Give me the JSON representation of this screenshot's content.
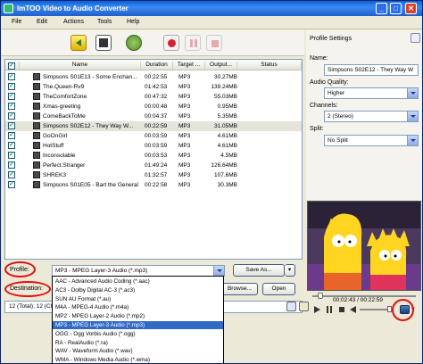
{
  "window": {
    "title": "ImTOO Video to Audio Converter",
    "buttons": [
      "_",
      "□",
      "✕"
    ]
  },
  "menu": [
    "File",
    "Edit",
    "Actions",
    "Tools",
    "Help"
  ],
  "list": {
    "columns": [
      "Name",
      "Duration",
      "Target ...",
      "Output...",
      "Status"
    ],
    "rows": [
      {
        "name": "Simpsons S01E13 - Some Enchan...",
        "duration": "00:22:55",
        "target": "MP3",
        "output": "30.27MB"
      },
      {
        "name": "The.Queen-Rv9",
        "duration": "01:42:53",
        "target": "MP3",
        "output": "139.24MB"
      },
      {
        "name": "TheComfortZone",
        "duration": "00:47:32",
        "target": "MP3",
        "output": "55.03MB"
      },
      {
        "name": "Xmas-greeting",
        "duration": "00:00:48",
        "target": "MP3",
        "output": "0.95MB"
      },
      {
        "name": "ComeBackToMe",
        "duration": "00:04:37",
        "target": "MP3",
        "output": "5.35MB"
      },
      {
        "name": "Simpsons S02E12 - They Way W...",
        "duration": "00:22:59",
        "target": "MP3",
        "output": "31.05MB"
      },
      {
        "name": "GoOnGirl",
        "duration": "00:03:59",
        "target": "MP3",
        "output": "4.61MB"
      },
      {
        "name": "HotStuff",
        "duration": "00:03:59",
        "target": "MP3",
        "output": "4.61MB"
      },
      {
        "name": "Inconsolable",
        "duration": "00:03:53",
        "target": "MP3",
        "output": "4.5MB"
      },
      {
        "name": "Perfect.Stranger",
        "duration": "01:49:24",
        "target": "MP3",
        "output": "126.64MB"
      },
      {
        "name": "SHREK3",
        "duration": "01:32:57",
        "target": "MP3",
        "output": "107.6MB"
      },
      {
        "name": "Simpsons S01E05 - Bart the General",
        "duration": "00:22:58",
        "target": "MP3",
        "output": "30.3MB"
      }
    ],
    "selected_index": 5
  },
  "panel": {
    "title": "Profile Settings",
    "name_label": "Name:",
    "name_value": "Simpsons S02E12 - They Way W",
    "quality_label": "Audio Quality:",
    "quality_value": "Higher",
    "channels_label": "Channels:",
    "channels_value": "2 (Stereo)",
    "split_label": "Split:",
    "split_value": "No Split"
  },
  "player": {
    "time": "00:02:43 / 00:22:59"
  },
  "profile": {
    "label": "Profile:",
    "value": "MP3 - MPEG Layer-3 Audio (*.mp3)",
    "save_as": "Save As...",
    "options": [
      "AAC - Advanced Audio Coding (*.aac)",
      "AC3 - Dolby Digital AC-3 (*.ac3)",
      "SUN AU Format (*.au)",
      "M4A - MPEG-4 Audio (*.m4a)",
      "MP2 - MPEG Layer-2 Audio (*.mp2)",
      "MP3 - MPEG Layer-3 Audio (*.mp3)",
      "OGG - Ogg Vorbis Audio (*.ogg)",
      "RA - RealAudio (*.ra)",
      "WAV - Waveform Audio (*.wav)",
      "WMA - Windows Media Audio (*.wma)"
    ],
    "selected_option": 5
  },
  "destination": {
    "label": "Destination:",
    "browse": "Browse...",
    "open": "Open"
  },
  "status": {
    "text": "12 (Total); 12 (Checked)"
  }
}
